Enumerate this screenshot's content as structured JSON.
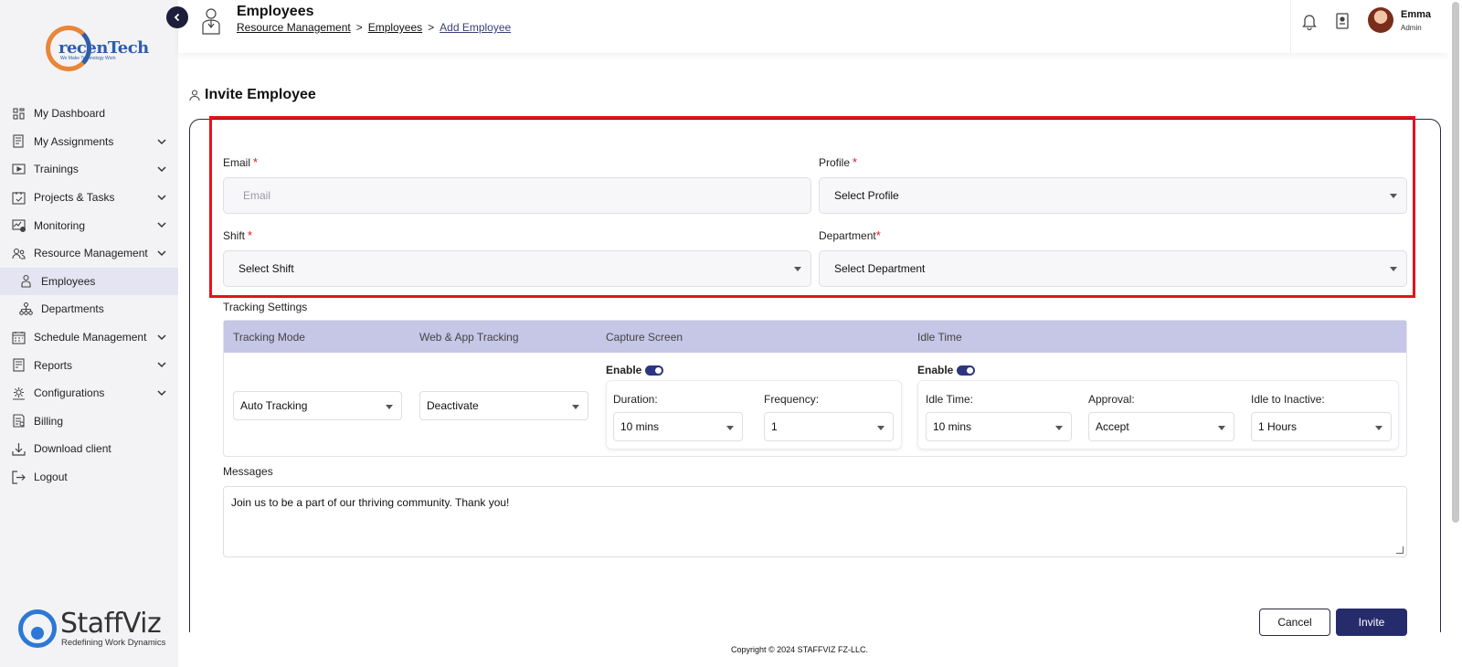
{
  "brand": {
    "logo_text": "recenTech",
    "logo_tagline": "We Make Technology Work",
    "footer_logo": "StaffViz",
    "footer_tagline": "Redefining Work Dynamics"
  },
  "sidebar": {
    "items": [
      {
        "label": "My Dashboard",
        "icon": "dashboard-icon",
        "chevron": false
      },
      {
        "label": "My Assignments",
        "icon": "assignments-icon",
        "chevron": true
      },
      {
        "label": "Trainings",
        "icon": "video-icon",
        "chevron": true
      },
      {
        "label": "Projects & Tasks",
        "icon": "clipboard-icon",
        "chevron": true
      },
      {
        "label": "Monitoring",
        "icon": "monitoring-icon",
        "chevron": true
      },
      {
        "label": "Resource Management",
        "icon": "people-icon",
        "chevron": true
      },
      {
        "label": "Employees",
        "icon": "person-icon",
        "chevron": false,
        "active": true
      },
      {
        "label": "Departments",
        "icon": "org-chart-icon",
        "chevron": false
      },
      {
        "label": "Schedule Management",
        "icon": "calendar-icon",
        "chevron": true
      },
      {
        "label": "Reports",
        "icon": "report-icon",
        "chevron": true
      },
      {
        "label": "Configurations",
        "icon": "gear-icon",
        "chevron": true
      },
      {
        "label": "Billing",
        "icon": "billing-icon",
        "chevron": false
      },
      {
        "label": "Download client",
        "icon": "download-icon",
        "chevron": false
      },
      {
        "label": "Logout",
        "icon": "logout-icon",
        "chevron": false
      }
    ]
  },
  "header": {
    "title": "Employees",
    "breadcrumb": [
      "Resource Management",
      "Employees",
      "Add Employee"
    ],
    "user_name": "Emma",
    "user_role": "Admin"
  },
  "form": {
    "section_title": "Invite Employee",
    "email_label": "Email",
    "email_placeholder": "Email",
    "profile_label": "Profile",
    "profile_value": "Select Profile",
    "shift_label": "Shift",
    "shift_value": "Select Shift",
    "department_label": "Department",
    "department_value": "Select Department",
    "required_mark": "*"
  },
  "tracking": {
    "label": "Tracking Settings",
    "headers": [
      "Tracking Mode",
      "Web & App Tracking",
      "Capture Screen",
      "Idle Time"
    ],
    "tracking_mode": "Auto Tracking",
    "web_app": "Deactivate",
    "enable_label": "Enable",
    "capture": {
      "duration_label": "Duration:",
      "duration_value": "10 mins",
      "frequency_label": "Frequency:",
      "frequency_value": "1"
    },
    "idle": {
      "idle_label": "Idle Time:",
      "idle_value": "10 mins",
      "approval_label": "Approval:",
      "approval_value": "Accept",
      "inactive_label": "Idle to Inactive:",
      "inactive_value": "1 Hours"
    }
  },
  "messages": {
    "label": "Messages",
    "value": "Join us to be a part of our thriving community. Thank you!"
  },
  "actions": {
    "cancel": "Cancel",
    "invite": "Invite"
  },
  "footer": {
    "copyright": "Copyright © 2024 STAFFVIZ FZ-LLC."
  },
  "colors": {
    "primary": "#262c6b",
    "highlight": "#e3141b",
    "table_header": "#c6c6e6",
    "sidebar_bg": "#f3f3f5"
  }
}
